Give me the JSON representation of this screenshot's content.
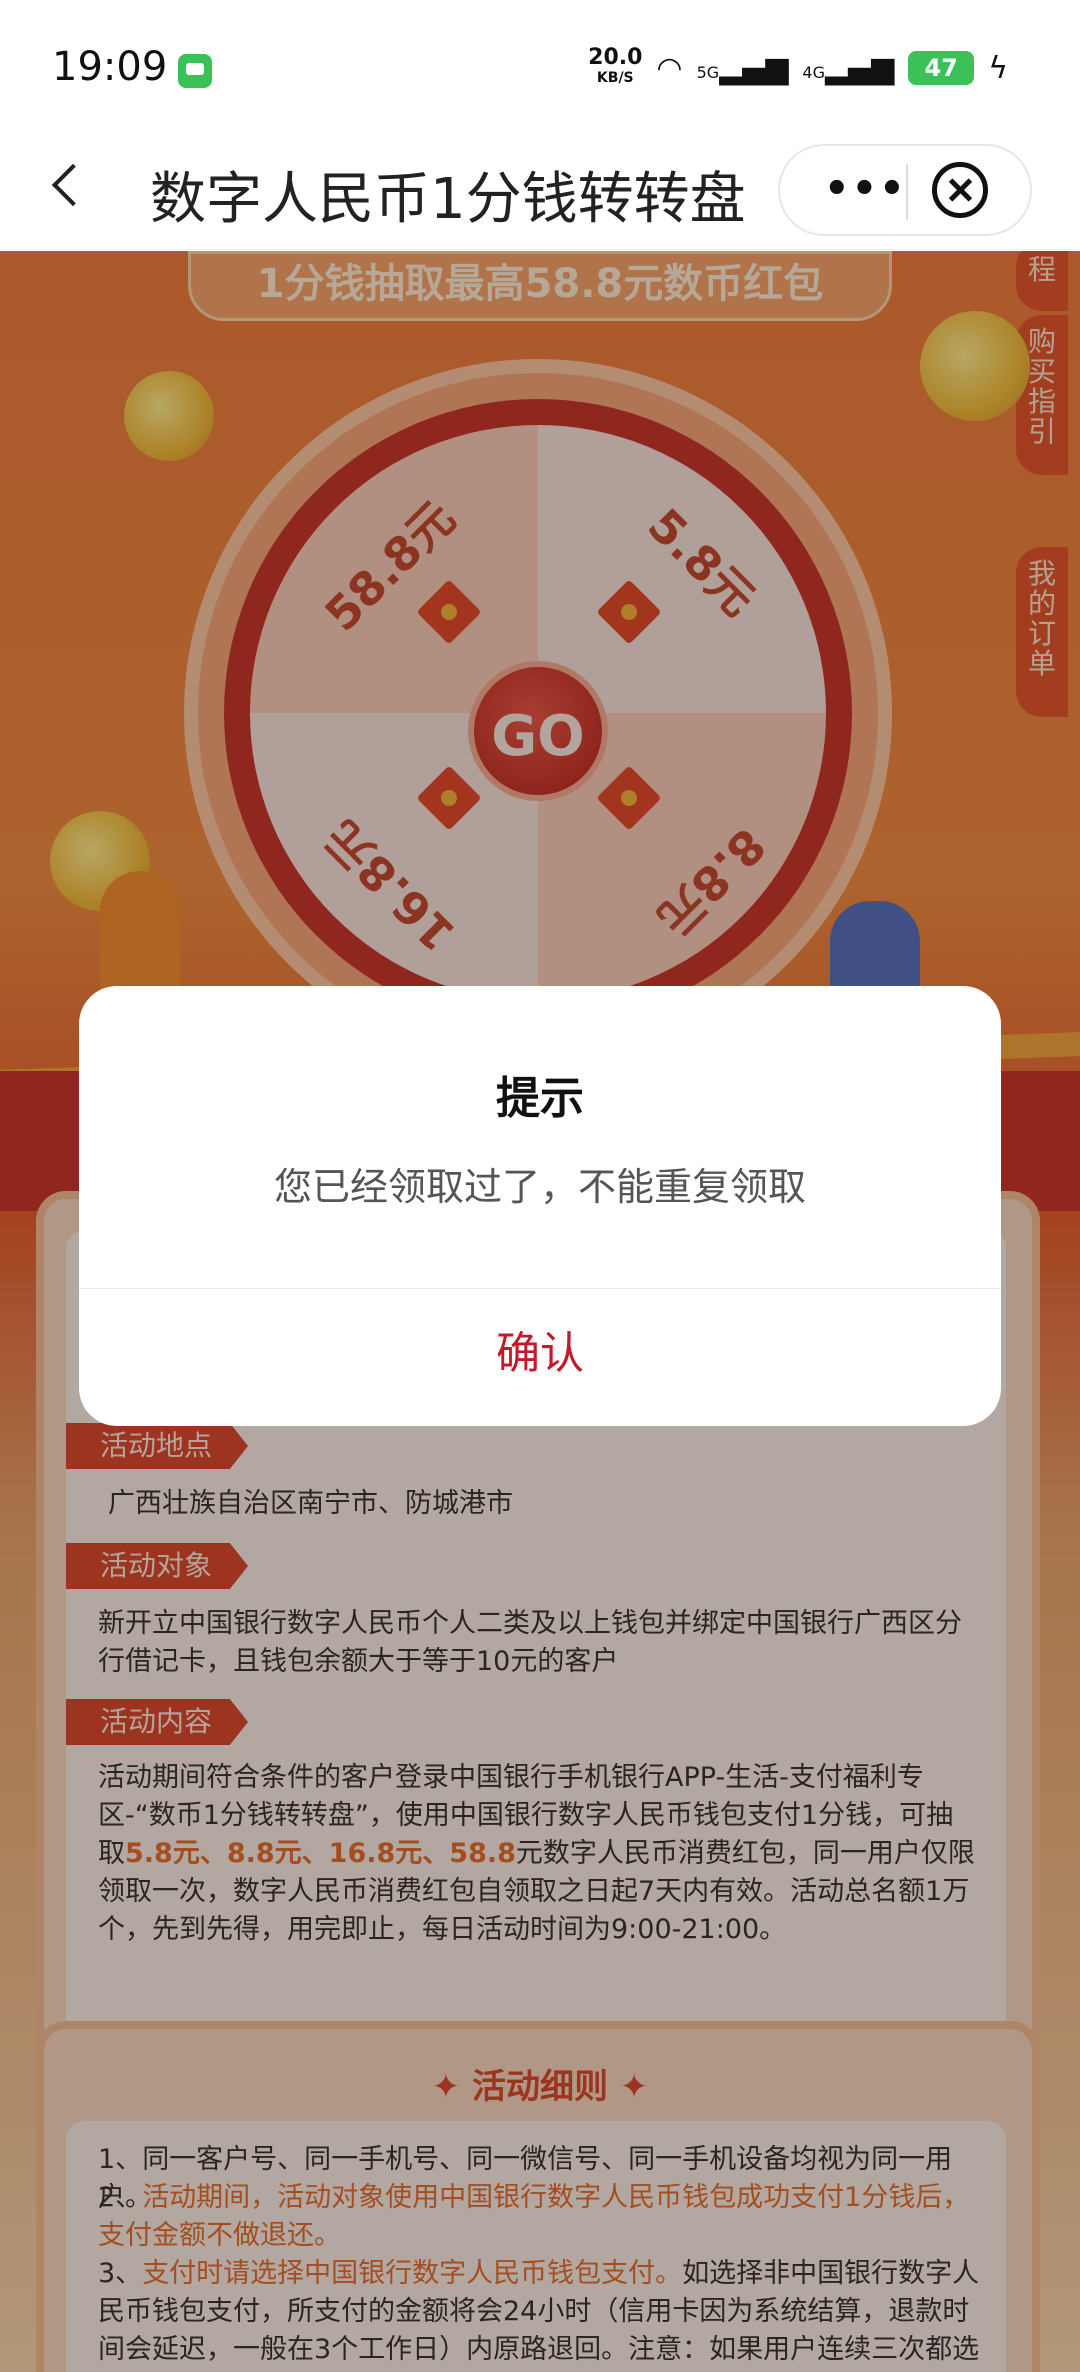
{
  "status_bar": {
    "time": "19:09",
    "net_speed": "20.0",
    "net_unit": "KB/S",
    "signal_1": "5G",
    "signal_2": "4G",
    "battery": "47"
  },
  "nav": {
    "title": "数字人民币1分钱转转盘",
    "more_icon": "more-icon",
    "close_icon": "close-icon"
  },
  "page": {
    "banner": "1分钱抽取最高58.8元数币红包",
    "side_tabs": [
      "程",
      "购买指引",
      "我的订单"
    ],
    "wheel": {
      "prizes": [
        "58.8元",
        "5.8元",
        "16.8元",
        "8.8元"
      ],
      "go_label": "GO"
    },
    "sections": [
      {
        "tag": "活动地点",
        "text": "广西壮族自治区南宁市、防城港市"
      },
      {
        "tag": "活动对象",
        "text": "新开立中国银行数字人民币个人二类及以上钱包并绑定中国银行广西区分行借记卡，且钱包余额大于等于10元的客户"
      },
      {
        "tag": "活动内容",
        "text_a": "活动期间符合条件的客户登录中国银行手机银行APP-生活-支付福利专区-“数币1分钱转转盘”，使用中国银行数字人民币钱包支付1分钱，可抽取",
        "text_highlight": "5.8元、8.8元、16.8元、58.8",
        "text_b": "元数字人民币消费红包，同一用户仅限领取一次，数字人民币消费红包自领取之日起7天内有效。活动总名额1万个，先到先得，用完即止，每日活动时间为9:00-21:00。"
      }
    ],
    "rules": {
      "title": "活动细则",
      "items": [
        {
          "prefix": "1、",
          "red": "",
          "text": "同一客户号、同一手机号、同一微信号、同一手机设备均视为同一用户。"
        },
        {
          "prefix": "2、",
          "red": "活动期间，活动对象使用中国银行数字人民币钱包成功支付1分钱后，支付金额不做退还。",
          "text": ""
        },
        {
          "prefix": "3、",
          "red": "支付时请选择中国银行数字人民币钱包支付。",
          "text": "如选择非中国银行数字人民币钱包支付，所支付的金额将会24小时（信用卡因为系统结算，退款时间会延迟，一般在3个工作日）内原路退回。注意：如果用户连续三次都选择非"
        }
      ]
    }
  },
  "dialog": {
    "title": "提示",
    "message": "您已经领取过了，不能重复领取",
    "confirm": "确认"
  },
  "colors": {
    "accent": "#c4192a",
    "page_orange": "#ef7b3c",
    "tag_red": "#d9492b"
  }
}
